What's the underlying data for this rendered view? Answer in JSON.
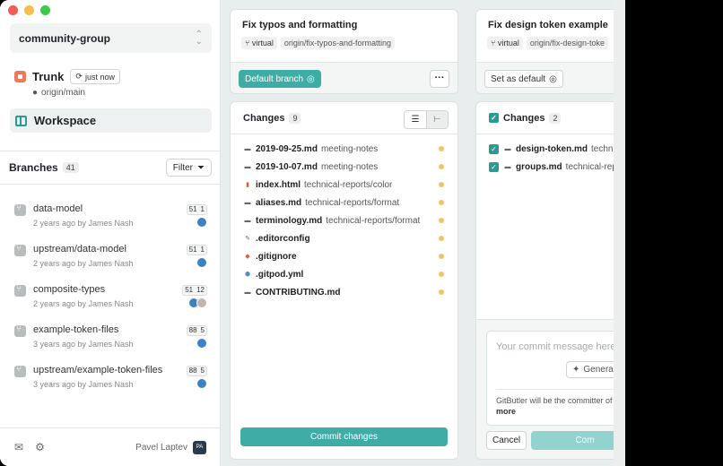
{
  "colors": {
    "accent": "#40aca6",
    "trunk": "#f07858",
    "modified_dot": "#f2c46a",
    "traffic_red": "#f05d57",
    "traffic_yellow": "#f6be4f",
    "traffic_green": "#3ec94a"
  },
  "sidebar": {
    "project_name": "community-group",
    "trunk": {
      "label": "Trunk",
      "time_badge": "just now",
      "remote": "origin/main"
    },
    "workspace_label": "Workspace",
    "branches": {
      "title": "Branches",
      "count": "41",
      "filter_label": "Filter",
      "items": [
        {
          "name": "data-model",
          "meta": "2 years ago by James Nash",
          "ahead": "51",
          "behind": "1"
        },
        {
          "name": "upstream/data-model",
          "meta": "2 years ago by James Nash",
          "ahead": "51",
          "behind": "1"
        },
        {
          "name": "composite-types",
          "meta": "2 years ago by James Nash",
          "ahead": "51",
          "behind": "12"
        },
        {
          "name": "example-token-files",
          "meta": "3 years ago by James Nash",
          "ahead": "88",
          "behind": "5"
        },
        {
          "name": "upstream/example-token-files",
          "meta": "3 years ago by James Nash",
          "ahead": "88",
          "behind": "5"
        }
      ]
    },
    "footer": {
      "user_name": "Pavel Laptev",
      "user_initials": "PA"
    }
  },
  "lanes": [
    {
      "title": "Fix typos and formatting",
      "tag_virtual": "virtual",
      "remote": "origin/fix-typos-and-formatting",
      "action_label": "Default branch",
      "changes_title": "Changes",
      "changes_count": "9",
      "files": [
        {
          "name": "2019-09-25.md",
          "path": "meeting-notes",
          "icon": "md-icon"
        },
        {
          "name": "2019-10-07.md",
          "path": "meeting-notes",
          "icon": "md-icon"
        },
        {
          "name": "index.html",
          "path": "technical-reports/color",
          "icon": "html-icon"
        },
        {
          "name": "aliases.md",
          "path": "technical-reports/format",
          "icon": "md-icon"
        },
        {
          "name": "terminology.md",
          "path": "technical-reports/format",
          "icon": "md-icon"
        },
        {
          "name": ".editorconfig",
          "path": "",
          "icon": "config-icon"
        },
        {
          "name": ".gitignore",
          "path": "",
          "icon": "git-icon"
        },
        {
          "name": ".gitpod.yml",
          "path": "",
          "icon": "gitpod-icon"
        },
        {
          "name": "CONTRIBUTING.md",
          "path": "",
          "icon": "md-icon"
        }
      ],
      "commit_label": "Commit changes"
    },
    {
      "title": "Fix design token example",
      "tag_virtual": "virtual",
      "remote": "origin/fix-design-toke",
      "action_label": "Set as default",
      "changes_title": "Changes",
      "changes_count": "2",
      "files": [
        {
          "name": "design-token.md",
          "path": "techni"
        },
        {
          "name": "groups.md",
          "path": "technical-rep"
        }
      ],
      "commit_placeholder": "Your commit message here",
      "generate_label": "Genera",
      "committer_note": "GitButler will be the committer of",
      "more_label": "more",
      "cancel_label": "Cancel",
      "commit_label": "Com"
    }
  ]
}
